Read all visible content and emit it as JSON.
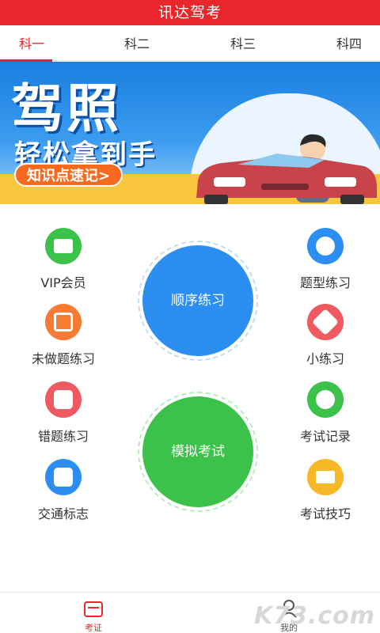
{
  "app": {
    "title": "讯达驾考",
    "accent": "#e8262c"
  },
  "tabs": [
    {
      "label": "科一",
      "active": true
    },
    {
      "label": "科二",
      "active": false
    },
    {
      "label": "科三",
      "active": false
    },
    {
      "label": "科四",
      "active": false
    }
  ],
  "banner": {
    "title": "驾照",
    "subtitle": "轻松拿到手",
    "button": "知识点速记>"
  },
  "grid": {
    "left": [
      {
        "label": "VIP会员",
        "icon": "vip-card-icon",
        "color": "#3cc24a"
      },
      {
        "label": "未做题练习",
        "icon": "list-icon",
        "color": "#f77b33"
      },
      {
        "label": "错题练习",
        "icon": "chart-icon",
        "color": "#ee5a5f"
      },
      {
        "label": "交通标志",
        "icon": "traffic-sign-icon",
        "color": "#2c8ef0"
      }
    ],
    "right": [
      {
        "label": "题型练习",
        "icon": "star-icon",
        "color": "#2c8ef0"
      },
      {
        "label": "小练习",
        "icon": "tag-icon",
        "color": "#ee5a5f"
      },
      {
        "label": "考试记录",
        "icon": "alert-icon",
        "color": "#3cc24a"
      },
      {
        "label": "考试技巧",
        "icon": "crown-icon",
        "color": "#f6b827"
      }
    ],
    "center": [
      {
        "label": "顺序练习",
        "color": "#2c8ef0"
      },
      {
        "label": "模拟考试",
        "color": "#3cc24a"
      }
    ]
  },
  "nav": [
    {
      "label": "考证",
      "icon": "exam-card-icon",
      "active": true
    },
    {
      "label": "我的",
      "icon": "profile-icon",
      "active": false
    }
  ],
  "watermark": "K73.com"
}
